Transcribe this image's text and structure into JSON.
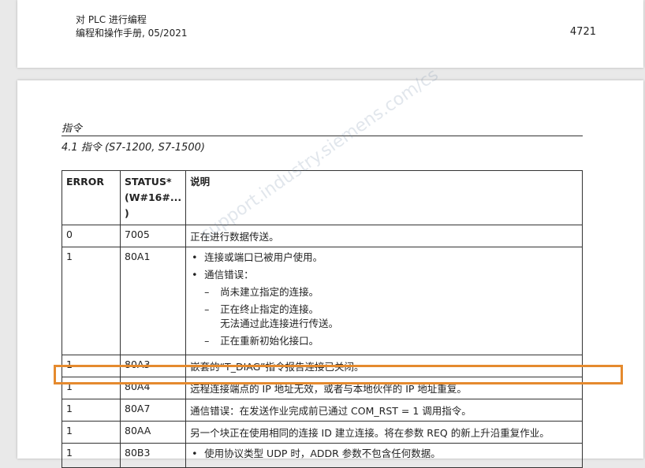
{
  "header": {
    "line1": "对 PLC 进行编程",
    "line2": "编程和操作手册, 05/2021",
    "page_number": "4721"
  },
  "section": {
    "title": "指令",
    "subtitle": "4.1 指令 (S7-1200, S7-1500)"
  },
  "table": {
    "headers": [
      "ERROR",
      "STATUS* (W#16#... )",
      "说明"
    ],
    "rows": [
      {
        "error": "0",
        "status": "7005",
        "desc": [
          "正在进行数据传送。"
        ]
      },
      {
        "error": "1",
        "status": "80A1",
        "desc": []
      },
      {
        "error": "1",
        "status": "80A3",
        "desc": [
          "嵌套的“T_DIAG”指令报告连接已关闭。"
        ]
      },
      {
        "error": "1",
        "status": "80A4",
        "desc": [
          "远程连接端点的 IP 地址无效，或者与本地伙伴的 IP 地址重复。"
        ]
      },
      {
        "error": "1",
        "status": "80A7",
        "desc": [
          "通信错误：在发送作业完成前已通过 COM_RST = 1 调用指令。"
        ]
      },
      {
        "error": "1",
        "status": "80AA",
        "desc": [
          "另一个块正在使用相同的连接 ID 建立连接。将在参数 REQ 的新上升沿重复作业。"
        ]
      },
      {
        "error": "1",
        "status": "80B3",
        "desc": []
      }
    ],
    "row_80a1": {
      "bullet1": "连接或端口已被用户使用。",
      "bullet2": "通信错误：",
      "dash1": "尚未建立指定的连接。",
      "dash2a": "正在终止指定的连接。",
      "dash2b": "无法通过此连接进行传送。",
      "dash3": "正在重新初始化接口。"
    },
    "row_80b3": {
      "bullet1": "使用协议类型 UDP 时，ADDR 参数不包含任何数据。"
    }
  },
  "watermark": "support.industry.siemens.com/cs",
  "highlight_color": "#e58a2e"
}
